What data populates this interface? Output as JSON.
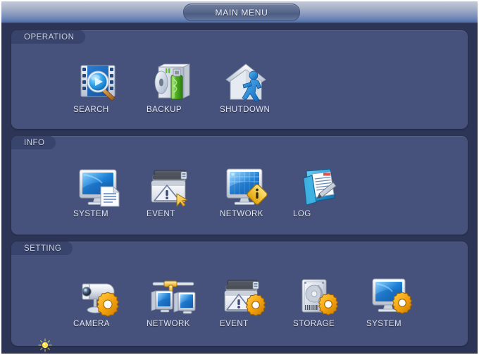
{
  "window": {
    "title": "MAIN MENU"
  },
  "colors": {
    "background": "#2d3556",
    "panel": "#47527c",
    "panel_label": "#39446c",
    "titlebar_top": "#c2c9d8",
    "titlebar_bottom": "#4e6fa8",
    "label_text": "#e4e9f4",
    "accent_gear": "#f2a81c",
    "accent_warning": "#e9ecf5",
    "cursor": "#ffe14d"
  },
  "sections": [
    {
      "id": "operation",
      "label": "OPERATION",
      "items": [
        {
          "id": "search",
          "label": "SEARCH",
          "icon": "film-search-icon"
        },
        {
          "id": "backup",
          "label": "BACKUP",
          "icon": "drive-usb-icon"
        },
        {
          "id": "shutdown",
          "label": "SHUTDOWN",
          "icon": "house-exit-icon"
        }
      ]
    },
    {
      "id": "info",
      "label": "INFO",
      "items": [
        {
          "id": "system",
          "label": "SYSTEM",
          "icon": "monitor-document-icon"
        },
        {
          "id": "event",
          "label": "EVENT",
          "icon": "windows-warning-icon"
        },
        {
          "id": "network",
          "label": "NETWORK",
          "icon": "monitor-info-icon"
        },
        {
          "id": "log",
          "label": "LOG",
          "icon": "folder-pen-icon"
        }
      ]
    },
    {
      "id": "setting",
      "label": "SETTING",
      "items": [
        {
          "id": "camera",
          "label": "CAMERA",
          "icon": "camera-gear-icon"
        },
        {
          "id": "network",
          "label": "NETWORK",
          "icon": "two-monitors-cable-icon"
        },
        {
          "id": "event",
          "label": "EVENT",
          "icon": "windows-warning-gear-icon"
        },
        {
          "id": "storage",
          "label": "STORAGE",
          "icon": "harddisk-gear-icon"
        },
        {
          "id": "system",
          "label": "SYSTEM",
          "icon": "monitor-gear-icon"
        }
      ]
    }
  ],
  "cursor": {
    "name": "sparkle-cursor"
  }
}
